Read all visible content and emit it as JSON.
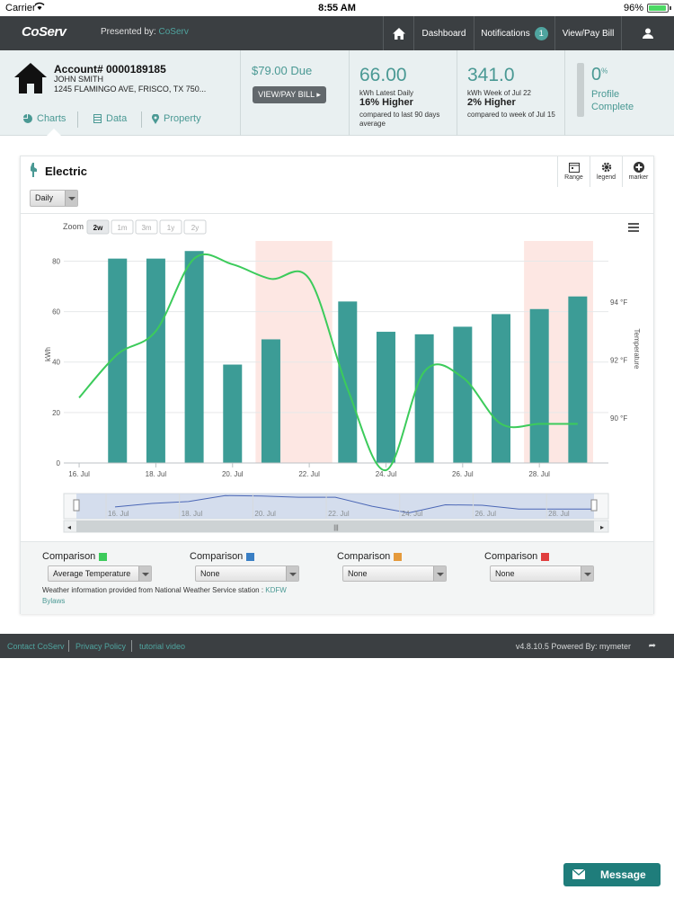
{
  "status_bar": {
    "carrier": "Carrier",
    "time": "8:55 AM",
    "battery": "96%"
  },
  "nav": {
    "logo": "CoServ",
    "presented_by": "Presented by:",
    "presented_brand": "CoServ",
    "dashboard": "Dashboard",
    "notifications": "Notifications",
    "notifications_count": "1",
    "view_pay_bill": "View/Pay Bill"
  },
  "account": {
    "number": "Account# 0000189185",
    "name": "JOHN SMITH",
    "address": "1245 FLAMINGO AVE, FRISCO, TX 750...",
    "tabs": {
      "charts": "Charts",
      "data": "Data",
      "property": "Property"
    },
    "due": "$79.00 Due",
    "due_button": "VIEW/PAY BILL",
    "daily": {
      "value": "66.00",
      "label": "kWh Latest Daily",
      "change": "16% Higher",
      "compare": "compared to last 90 days average"
    },
    "weekly": {
      "value": "341.0",
      "label": "kWh Week of Jul 22",
      "change": "2% Higher",
      "compare": "compared to week of Jul 15"
    },
    "profile": {
      "value": "0",
      "unit": "%",
      "label": "Profile Complete",
      "fraction": 0
    }
  },
  "card": {
    "title": "Electric",
    "tools": {
      "range": "Range",
      "legend": "legend",
      "marker": "marker"
    },
    "interval": "Daily",
    "zoom_label": "Zoom",
    "zoom_options": [
      "2w",
      "1m",
      "3m",
      "1y",
      "2y"
    ],
    "comparisons": [
      {
        "label": "Comparison",
        "value": "Average Temperature",
        "color": "#3ccb5b"
      },
      {
        "label": "Comparison",
        "value": "None",
        "color": "#3a7fc4"
      },
      {
        "label": "Comparison",
        "value": "None",
        "color": "#e59a3c"
      },
      {
        "label": "Comparison",
        "value": "None",
        "color": "#e03e3e"
      }
    ],
    "weather_text": "Weather information provided from National Weather Service station :",
    "weather_station": "KDFW",
    "bylaws": "Bylaws"
  },
  "chart_data": {
    "type": "bar",
    "ylabel": "kWh",
    "ylabel_right": "Temperature",
    "y_ticks": [
      0,
      20,
      40,
      60,
      80
    ],
    "ylim": [
      0,
      88
    ],
    "y2_ticks": [
      "90 °F",
      "92 °F",
      "94 °F"
    ],
    "y2_values": [
      90,
      92,
      94
    ],
    "x_ticks": [
      "16. Jul",
      "18. Jul",
      "20. Jul",
      "22. Jul",
      "24. Jul",
      "26. Jul",
      "28. Jul"
    ],
    "navigator_ticks": [
      "16. Jul",
      "18. Jul",
      "20. Jul",
      "22. Jul",
      "24. Jul",
      "26. Jul",
      "28. Jul"
    ],
    "days": [
      16,
      17,
      18,
      19,
      20,
      21,
      22,
      23,
      24,
      25,
      26,
      27,
      28,
      29
    ],
    "kwh": [
      null,
      81,
      81,
      84,
      39,
      49,
      null,
      64,
      52,
      51,
      54,
      59,
      61,
      66
    ],
    "temperature": [
      90.7,
      92.2,
      93.0,
      95.5,
      95.3,
      94.8,
      94.8,
      91.0,
      88.2,
      91.6,
      91.4,
      89.8,
      89.8,
      89.8
    ],
    "shaded_days": [
      [
        20.6,
        22.6
      ],
      [
        27.6,
        29.4
      ]
    ],
    "colors": {
      "bar": "#3c9c96",
      "line": "#3ccb5b",
      "shade": "#fde7e3"
    }
  },
  "footer": {
    "links": [
      "Contact CoServ",
      "Privacy Policy",
      "tutorial video"
    ],
    "version": "v4.8.10.5 Powered By:",
    "brand": "mymeter"
  },
  "message_button": "Message"
}
